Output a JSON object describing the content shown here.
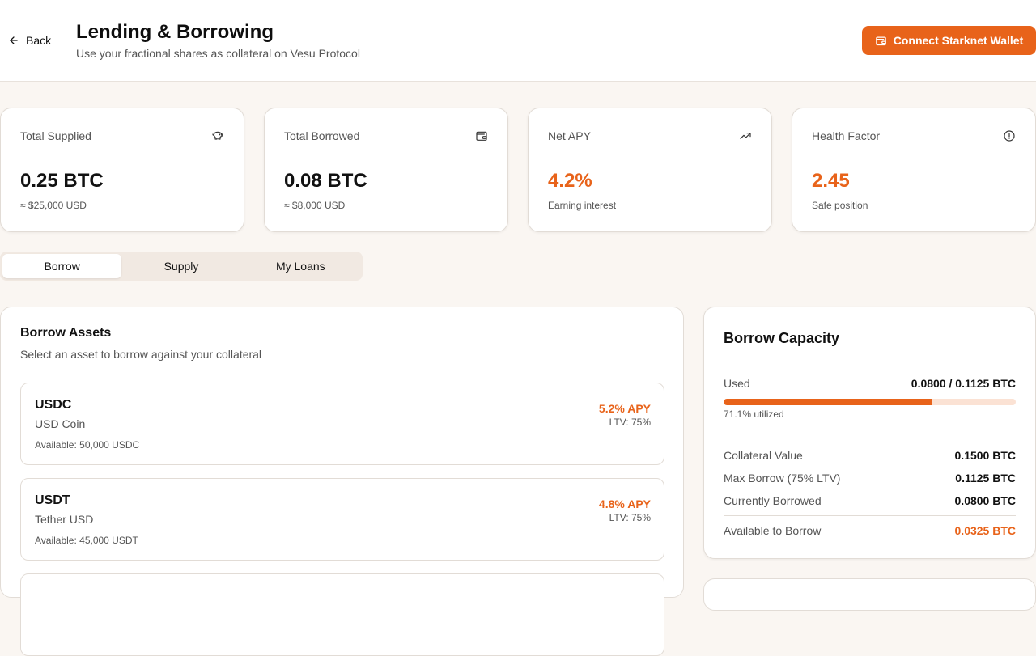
{
  "header": {
    "back_label": "Back",
    "title": "Lending & Borrowing",
    "subtitle": "Use your fractional shares as collateral on Vesu Protocol",
    "connect_label": "Connect Starknet Wallet"
  },
  "stats": [
    {
      "label": "Total Supplied",
      "value": "0.25 BTC",
      "sub": "≈ $25,000 USD",
      "icon": "piggy-bank-icon"
    },
    {
      "label": "Total Borrowed",
      "value": "0.08 BTC",
      "sub": "≈ $8,000 USD",
      "icon": "wallet-icon"
    },
    {
      "label": "Net APY",
      "value": "4.2%",
      "sub": "Earning interest",
      "icon": "trending-up-icon"
    },
    {
      "label": "Health Factor",
      "value": "2.45",
      "sub": "Safe position",
      "icon": "alert-circle-icon"
    }
  ],
  "tabs": [
    {
      "label": "Borrow",
      "active": true
    },
    {
      "label": "Supply",
      "active": false
    },
    {
      "label": "My Loans",
      "active": false
    }
  ],
  "borrow": {
    "title": "Borrow Assets",
    "subtitle": "Select an asset to borrow against your collateral",
    "assets": [
      {
        "symbol": "USDC",
        "name": "USD Coin",
        "available": "Available: 50,000 USDC",
        "apy": "5.2% APY",
        "ltv": "LTV: 75%"
      },
      {
        "symbol": "USDT",
        "name": "Tether USD",
        "available": "Available: 45,000 USDT",
        "apy": "4.8% APY",
        "ltv": "LTV: 75%"
      }
    ]
  },
  "capacity": {
    "title": "Borrow Capacity",
    "used_label": "Used",
    "used_value": "0.0800 / 0.1125 BTC",
    "utilization_percent": 71.1,
    "utilized_text": "71.1% utilized",
    "rows": [
      {
        "label": "Collateral Value",
        "value": "0.1500 BTC"
      },
      {
        "label": "Max Borrow (75% LTV)",
        "value": "0.1125 BTC"
      },
      {
        "label": "Currently Borrowed",
        "value": "0.0800 BTC"
      }
    ],
    "available_label": "Available to Borrow",
    "available_value": "0.0325 BTC"
  },
  "colors": {
    "accent": "#e8631a",
    "accent_light": "#fbe2d4",
    "background": "#faf6f2"
  }
}
